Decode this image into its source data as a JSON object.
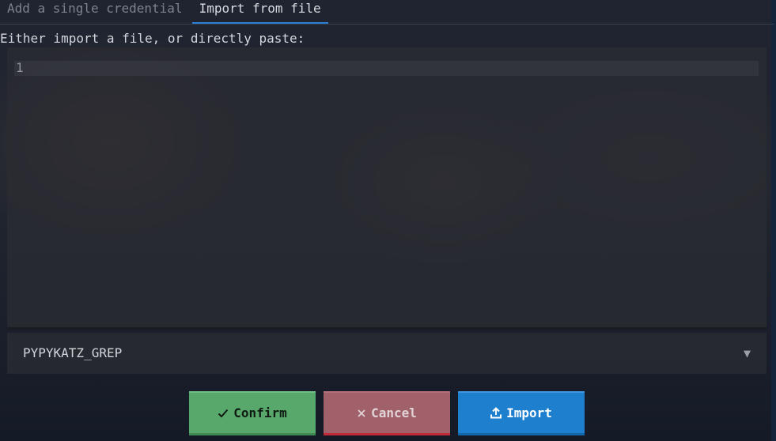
{
  "tabs": [
    {
      "label": "Add a single credential",
      "active": false
    },
    {
      "label": "Import from file",
      "active": true
    }
  ],
  "prompt": "Either import a file, or directly paste:",
  "editor": {
    "line_numbers": [
      "1"
    ],
    "content": ""
  },
  "parser_select": {
    "value": "PYPYKATZ_GREP",
    "arrow_icon": "triangle-down-icon"
  },
  "buttons": {
    "confirm": {
      "label": "Confirm",
      "icon": "check-icon",
      "color": "#59a86b"
    },
    "cancel": {
      "label": "Cancel",
      "icon": "close-icon",
      "color": "#a1616a"
    },
    "import": {
      "label": "Import",
      "icon": "upload-icon",
      "color": "#1f7fcf"
    }
  },
  "colors": {
    "accent": "#2a7fd4",
    "background": "#1f2430"
  }
}
